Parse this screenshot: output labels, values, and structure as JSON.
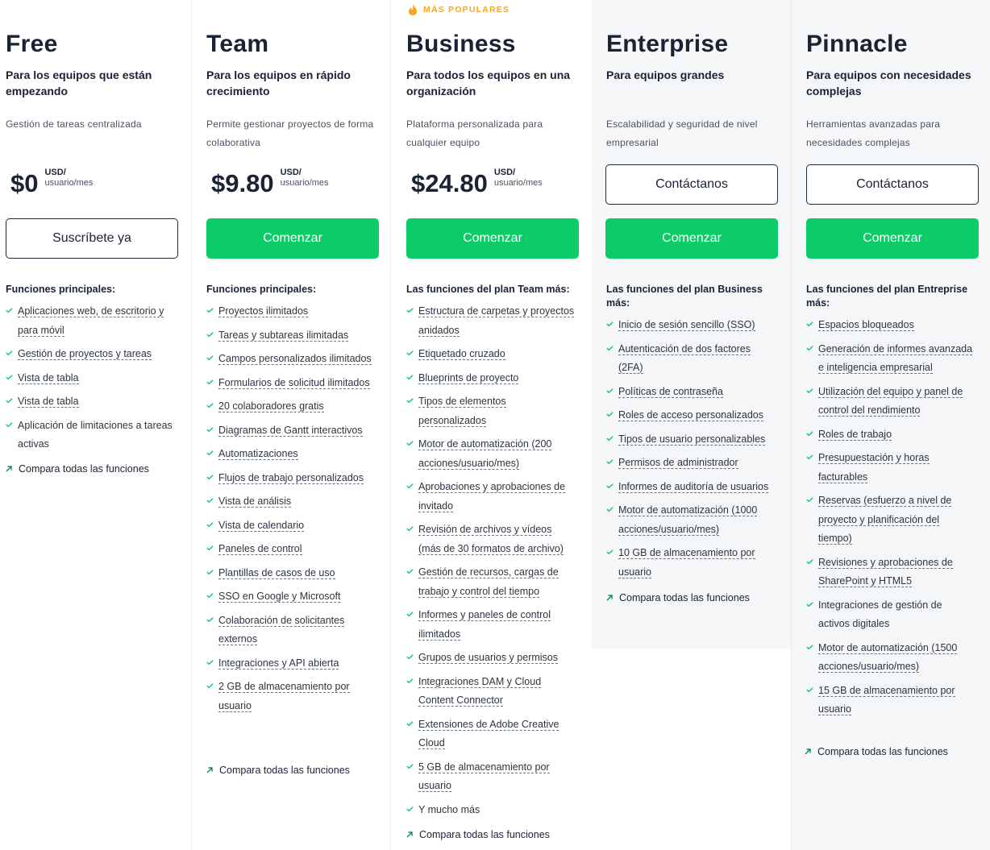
{
  "popular_label": "MÁS POPULARES",
  "plans": [
    {
      "name": "Free",
      "for": "Para los equipos que están empezando",
      "desc": "Gestión de tareas centralizada",
      "price": "$0",
      "currency": "USD/",
      "period": "usuario/mes",
      "button": "Suscríbete ya",
      "features_title": "Funciones principales:",
      "features": [
        {
          "text": "Aplicaciones web, de escritorio y para móvil",
          "dashed": true
        },
        {
          "text": "Gestión de proyectos y tareas",
          "dashed": true
        },
        {
          "text": "Vista de tabla",
          "dashed": true
        },
        {
          "text": "Vista de tabla",
          "dashed": true
        },
        {
          "text": "Aplicación de limitaciones a tareas activas",
          "dashed": false
        }
      ],
      "compare": "Compara todas las funciones"
    },
    {
      "name": "Team",
      "for": "Para los equipos en rápido crecimiento",
      "desc": "Permite gestionar proyectos de forma colaborativa",
      "price": "$9.80",
      "currency": "USD/",
      "period": "usuario/mes",
      "button": "Comenzar",
      "features_title": "Funciones principales:",
      "features": [
        {
          "text": "Proyectos ilimitados",
          "dashed": true
        },
        {
          "text": "Tareas y subtareas ilimitadas",
          "dashed": true
        },
        {
          "text": "Campos personalizados ilimitados",
          "dashed": true
        },
        {
          "text": "Formularios de solicitud ilimitados",
          "dashed": true
        },
        {
          "text": "20 colaboradores gratis",
          "dashed": true
        },
        {
          "text": "Diagramas de Gantt interactivos",
          "dashed": true
        },
        {
          "text": "Automatizaciones",
          "dashed": true
        },
        {
          "text": "Flujos de trabajo personalizados",
          "dashed": true
        },
        {
          "text": "Vista de análisis",
          "dashed": true
        },
        {
          "text": "Vista de calendario",
          "dashed": true
        },
        {
          "text": "Paneles de control",
          "dashed": true
        },
        {
          "text": "Plantillas de casos de uso",
          "dashed": true
        },
        {
          "text": "SSO en Google y Microsoft",
          "dashed": true
        },
        {
          "text": "Colaboración de solicitantes externos",
          "dashed": true
        },
        {
          "text": "Integraciones y API abierta",
          "dashed": true
        },
        {
          "text": "2 GB de almacenamiento por usuario",
          "dashed": true
        }
      ],
      "compare": "Compara todas las funciones"
    },
    {
      "name": "Business",
      "for": "Para todos los equipos en una organización",
      "desc": "Plataforma personalizada para cualquier equipo",
      "price": "$24.80",
      "currency": "USD/",
      "period": "usuario/mes",
      "button": "Comenzar",
      "features_title": "Las funciones del plan Team más:",
      "features": [
        {
          "text": "Estructura de carpetas y proyectos anidados",
          "dashed": true
        },
        {
          "text": "Etiquetado cruzado",
          "dashed": true
        },
        {
          "text": "Blueprints de proyecto",
          "dashed": true
        },
        {
          "text": "Tipos de elementos personalizados",
          "dashed": true
        },
        {
          "text": "Motor de automatización (200 acciones/usuario/mes)",
          "dashed": true
        },
        {
          "text": "Aprobaciones y aprobaciones de invitado",
          "dashed": true
        },
        {
          "text": "Revisión de archivos y vídeos (más de 30 formatos de archivo)",
          "dashed": true
        },
        {
          "text": "Gestión de recursos, cargas de trabajo y control del tiempo",
          "dashed": true
        },
        {
          "text": "Informes y paneles de control ilimitados",
          "dashed": true
        },
        {
          "text": "Grupos de usuarios y permisos",
          "dashed": true
        },
        {
          "text": "Integraciones DAM y Cloud Content Connector",
          "dashed": true
        },
        {
          "text": "Extensiones de Adobe Creative Cloud",
          "dashed": true
        },
        {
          "text": "5 GB de almacenamiento por usuario",
          "dashed": true
        },
        {
          "text": "Y mucho más",
          "dashed": false
        }
      ],
      "compare": "Compara todas las funciones"
    },
    {
      "name": "Enterprise",
      "for": "Para equipos grandes",
      "desc": "Escalabilidad y seguridad de nivel empresarial",
      "contact": "Contáctanos",
      "button": "Comenzar",
      "features_title": "Las funciones del plan Business más:",
      "features": [
        {
          "text": "Inicio de sesión sencillo (SSO)",
          "dashed": true
        },
        {
          "text": "Autenticación de dos factores (2FA)",
          "dashed": true
        },
        {
          "text": "Políticas de contraseña",
          "dashed": true
        },
        {
          "text": "Roles de acceso personalizados",
          "dashed": true
        },
        {
          "text": "Tipos de usuario personalizables",
          "dashed": true
        },
        {
          "text": "Permisos de administrador",
          "dashed": true
        },
        {
          "text": "Informes de auditoría de usuarios",
          "dashed": true
        },
        {
          "text": "Motor de automatización (1000 acciones/usuario/mes)",
          "dashed": true
        },
        {
          "text": "10 GB de almacenamiento por usuario",
          "dashed": true
        }
      ],
      "compare": "Compara todas las funciones"
    },
    {
      "name": "Pinnacle",
      "for": "Para equipos con necesidades complejas",
      "desc": "Herramientas avanzadas para necesidades complejas",
      "contact": "Contáctanos",
      "button": "Comenzar",
      "features_title": "Las funciones del plan Entreprise más:",
      "features": [
        {
          "text": "Espacios bloqueados",
          "dashed": true
        },
        {
          "text": "Generación de informes avanzada e inteligencia empresarial",
          "dashed": true
        },
        {
          "text": "Utilización del equipo y panel de control del rendimiento",
          "dashed": true
        },
        {
          "text": "Roles de trabajo",
          "dashed": true
        },
        {
          "text": "Presupuestación y horas facturables",
          "dashed": true
        },
        {
          "text": "Reservas (esfuerzo a nivel de proyecto y planificación del tiempo)",
          "dashed": true
        },
        {
          "text": "Revisiones y aprobaciones de SharePoint y HTML5",
          "dashed": true
        },
        {
          "text": "Integraciones de gestión de activos digitales",
          "dashed": false
        },
        {
          "text": "Motor de automatización (1500 acciones/usuario/mes)",
          "dashed": true
        },
        {
          "text": "15 GB de almacenamiento por usuario",
          "dashed": true
        }
      ],
      "compare": "Compara todas las funciones"
    }
  ],
  "colors": {
    "green": "#0ccc68",
    "dark": "#1a2233",
    "popular": "#f5a623",
    "shade": "#f5f6f8"
  }
}
